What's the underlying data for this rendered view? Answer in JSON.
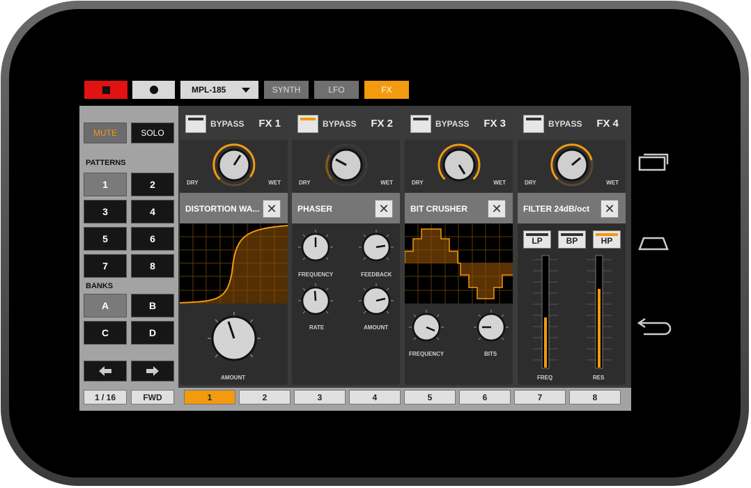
{
  "colors": {
    "accent": "#f39a0e",
    "stop_red": "#e01212",
    "panel": "#2d2d2d"
  },
  "topbar": {
    "stop_icon": "stop-icon",
    "record_icon": "record-icon",
    "instrument": "MPL-185",
    "tabs": [
      {
        "label": "SYNTH",
        "active": false
      },
      {
        "label": "LFO",
        "active": false
      },
      {
        "label": "FX",
        "active": true
      }
    ]
  },
  "sidebar": {
    "mute": "MUTE",
    "solo": "SOLO",
    "patterns_label": "PATTERNS",
    "patterns": [
      "1",
      "2",
      "3",
      "4",
      "5",
      "6",
      "7",
      "8"
    ],
    "banks_label": "BANKS",
    "banks": [
      "A",
      "B",
      "C",
      "D"
    ],
    "prev_icon": "arrow-left-icon",
    "next_icon": "arrow-right-icon"
  },
  "fx": [
    {
      "bypass": "BYPASS",
      "label": "FX 1",
      "bypass_on": false,
      "dry": "DRY",
      "wet": "WET",
      "name": "DISTORTION WA...",
      "params": [
        "AMOUNT"
      ]
    },
    {
      "bypass": "BYPASS",
      "label": "FX 2",
      "bypass_on": true,
      "dry": "DRY",
      "wet": "WET",
      "name": "PHASER",
      "params": [
        "FREQUENCY",
        "FEEDBACK",
        "RATE",
        "AMOUNT"
      ]
    },
    {
      "bypass": "BYPASS",
      "label": "FX 3",
      "bypass_on": false,
      "dry": "DRY",
      "wet": "WET",
      "name": "BIT CRUSHER",
      "params": [
        "FREQUENCY",
        "BITS"
      ]
    },
    {
      "bypass": "BYPASS",
      "label": "FX 4",
      "bypass_on": false,
      "dry": "DRY",
      "wet": "WET",
      "name": "FILTER 24dB/oct",
      "params": [
        "FREQ",
        "RES"
      ],
      "filter_types": [
        {
          "label": "LP",
          "active": false
        },
        {
          "label": "BP",
          "active": false
        },
        {
          "label": "HP",
          "active": true
        }
      ]
    }
  ],
  "bottombar": {
    "step": "1 / 16",
    "direction": "FWD",
    "pages": [
      {
        "label": "1",
        "active": true
      },
      {
        "label": "2",
        "active": false
      },
      {
        "label": "3",
        "active": false
      },
      {
        "label": "4",
        "active": false
      },
      {
        "label": "5",
        "active": false
      },
      {
        "label": "6",
        "active": false
      },
      {
        "label": "7",
        "active": false
      },
      {
        "label": "8",
        "active": false
      }
    ]
  },
  "android_nav": {
    "recents": "recents-icon",
    "home": "home-icon",
    "back": "back-icon"
  }
}
